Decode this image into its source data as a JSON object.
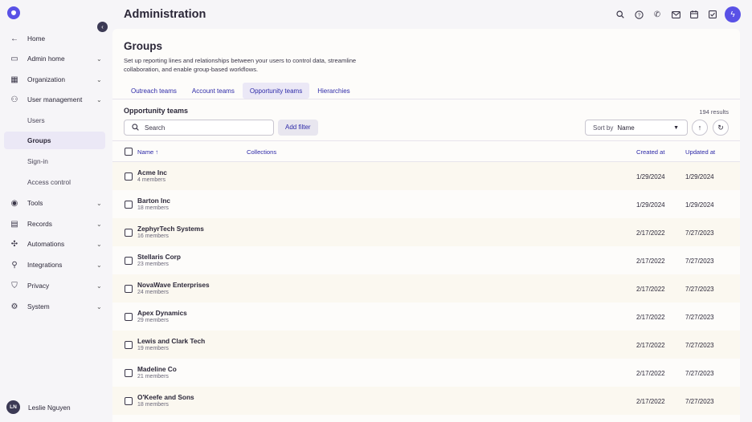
{
  "sidebar": {
    "items": [
      {
        "label": "Home",
        "icon": "arrow-left-icon",
        "glyph": "←"
      },
      {
        "label": "Admin home",
        "icon": "admin-home-icon",
        "glyph": "▭",
        "expandable": true
      },
      {
        "label": "Organization",
        "icon": "building-icon",
        "glyph": "▦",
        "expandable": true
      },
      {
        "label": "User management",
        "icon": "users-icon",
        "glyph": "⚇",
        "expandable": true
      },
      {
        "label": "Users",
        "sub": true
      },
      {
        "label": "Groups",
        "sub": true,
        "active": true
      },
      {
        "label": "Sign-in",
        "sub": true
      },
      {
        "label": "Access control",
        "sub": true
      },
      {
        "label": "Tools",
        "icon": "tools-icon",
        "glyph": "◉",
        "expandable": true
      },
      {
        "label": "Records",
        "icon": "records-icon",
        "glyph": "▤",
        "expandable": true
      },
      {
        "label": "Automations",
        "icon": "automations-icon",
        "glyph": "✣",
        "expandable": true
      },
      {
        "label": "Integrations",
        "icon": "integrations-icon",
        "glyph": "⚲",
        "expandable": true
      },
      {
        "label": "Privacy",
        "icon": "shield-icon",
        "glyph": "⛉",
        "expandable": true
      },
      {
        "label": "System",
        "icon": "system-icon",
        "glyph": "⚙",
        "expandable": true
      }
    ],
    "user": {
      "initials": "LN",
      "name": "Leslie Nguyen"
    }
  },
  "header": {
    "title": "Administration",
    "icons": [
      "search-icon",
      "help-icon",
      "phone-icon",
      "mail-icon",
      "calendar-icon",
      "tasks-icon"
    ]
  },
  "page": {
    "title": "Groups",
    "description": "Set up reporting lines and relationships between your users to control data, streamline collaboration, and enable group-based workflows.",
    "tabs": [
      {
        "label": "Outreach teams"
      },
      {
        "label": "Account teams"
      },
      {
        "label": "Opportunity teams",
        "active": true
      },
      {
        "label": "Hierarchies"
      }
    ],
    "section_title": "Opportunity teams",
    "results": "194 results",
    "search": {
      "placeholder": "Search"
    },
    "add_filter": "Add filter",
    "sort": {
      "label": "Sort by",
      "value": "Name"
    }
  },
  "table": {
    "headers": {
      "name": "Name",
      "collections": "Collections",
      "created": "Created at",
      "updated": "Updated at"
    },
    "rows": [
      {
        "name": "Acme Inc",
        "members": "4 members",
        "created": "1/29/2024",
        "updated": "1/29/2024"
      },
      {
        "name": "Barton Inc",
        "members": "18 members",
        "created": "1/29/2024",
        "updated": "1/29/2024"
      },
      {
        "name": "ZephyrTech Systems",
        "members": "16 members",
        "created": "2/17/2022",
        "updated": "7/27/2023"
      },
      {
        "name": "Stellaris Corp",
        "members": "23 members",
        "created": "2/17/2022",
        "updated": "7/27/2023"
      },
      {
        "name": "NovaWave Enterprises",
        "members": "24 members",
        "created": "2/17/2022",
        "updated": "7/27/2023"
      },
      {
        "name": "Apex Dynamics",
        "members": "29 members",
        "created": "2/17/2022",
        "updated": "7/27/2023"
      },
      {
        "name": "Lewis and Clark Tech",
        "members": "19 members",
        "created": "2/17/2022",
        "updated": "7/27/2023"
      },
      {
        "name": "Madeline Co",
        "members": "21 members",
        "created": "2/17/2022",
        "updated": "7/27/2023"
      },
      {
        "name": "O'Keefe and Sons",
        "members": "18 members",
        "created": "2/17/2022",
        "updated": "7/27/2023"
      }
    ]
  },
  "colors": {
    "accent": "#5951e6",
    "link": "#2e2aa8",
    "active_bg": "#ebe8f6"
  }
}
